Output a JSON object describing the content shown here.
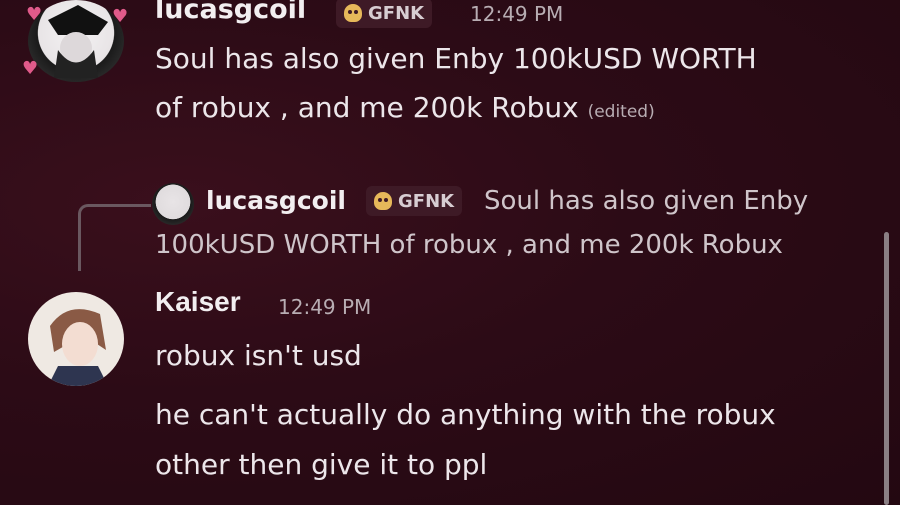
{
  "msg1": {
    "username": "lucasgcoil",
    "tag": "GFNK",
    "time": "12:49 PM",
    "line1": "Soul has also given Enby 100kUSD WORTH",
    "line2": "of robux , and me 200k Robux",
    "edited": "(edited)"
  },
  "reply": {
    "username": "lucasgcoil",
    "tag": "GFNK",
    "preview1": "Soul has also given Enby",
    "preview2": "100kUSD WORTH of robux , and me 200k Robux"
  },
  "msg2": {
    "username": "Kaiser",
    "time": "12:49 PM",
    "line1": "robux isn't usd",
    "line2": "he can't actually do anything with the robux",
    "line3": "other then give it to ppl"
  },
  "icons": {
    "tag_icon": "skull-icon",
    "avatar_decoration": "heart-icon"
  },
  "colors": {
    "background": "#2c0b16",
    "tag_bg": "#3e1a26",
    "skull": "#e6b85a"
  }
}
